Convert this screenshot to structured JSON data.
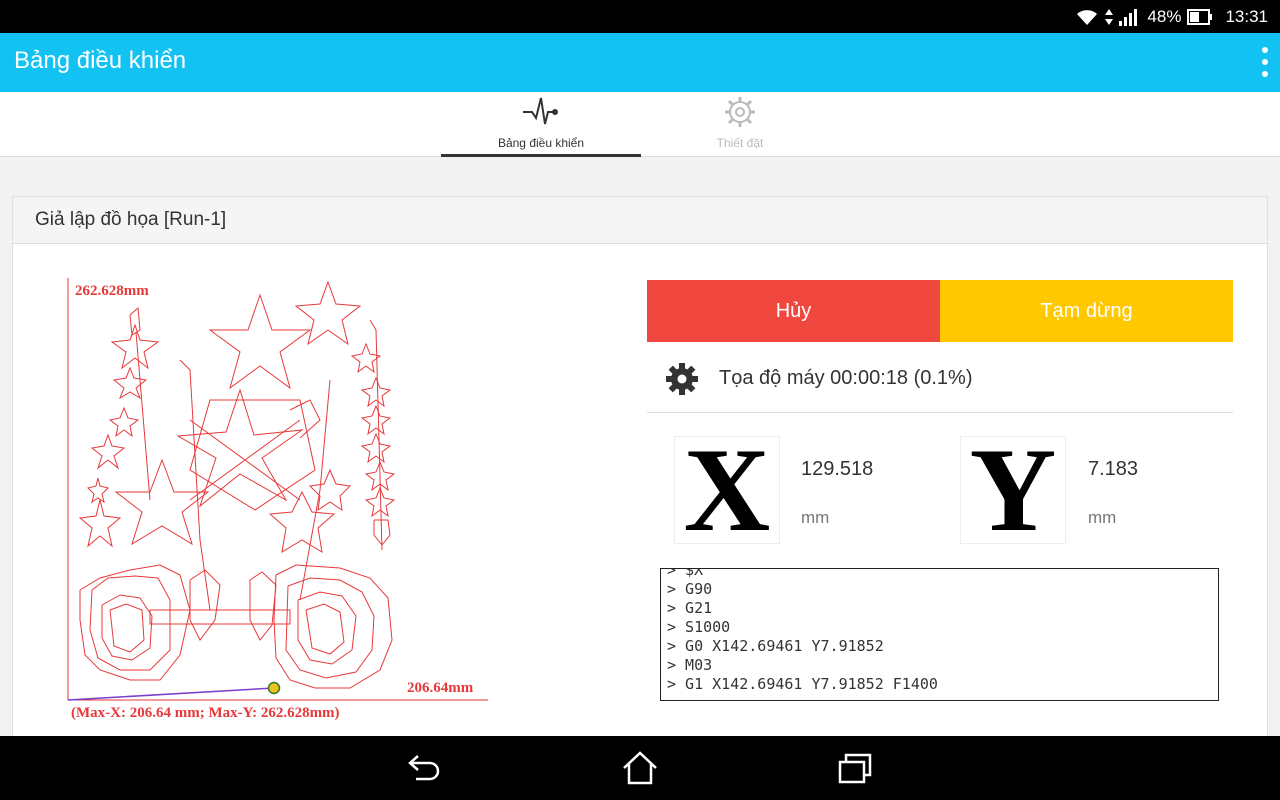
{
  "status_bar": {
    "battery": "48%",
    "time": "13:31"
  },
  "app_bar": {
    "title": "Bảng điều khiển"
  },
  "tabs": [
    {
      "label": "Bảng điều khiển",
      "icon": "pulse-icon",
      "active": true
    },
    {
      "label": "Thiết đặt",
      "icon": "gear-icon",
      "active": false
    }
  ],
  "card": {
    "title": "Giả lập đồ họa [Run-1]"
  },
  "plot": {
    "y_max_label": "262.628mm",
    "x_max_label": "206.64mm",
    "bounds_label": "(Max-X: 206.64 mm; Max-Y: 262.628mm)",
    "colors": {
      "path": "#e8383a",
      "axis": "#e8383a",
      "travel": "#7a3fd0",
      "marker": "#f0c020"
    }
  },
  "controls": {
    "cancel_label": "Hủy",
    "pause_label": "Tạm dừng",
    "cancel_color": "#f0483e",
    "pause_color": "#ffc800"
  },
  "status": {
    "text": "Tọa độ máy 00:00:18 (0.1%)"
  },
  "axes": {
    "x": {
      "letter": "X",
      "value": "129.518",
      "unit": "mm"
    },
    "y": {
      "letter": "Y",
      "value": "7.183",
      "unit": "mm"
    }
  },
  "console": {
    "lines": [
      "> $X",
      "> G90",
      "> G21",
      "> S1000",
      "> G0 X142.69461 Y7.91852",
      "> M03",
      "> G1 X142.69461 Y7.91852 F1400"
    ]
  }
}
